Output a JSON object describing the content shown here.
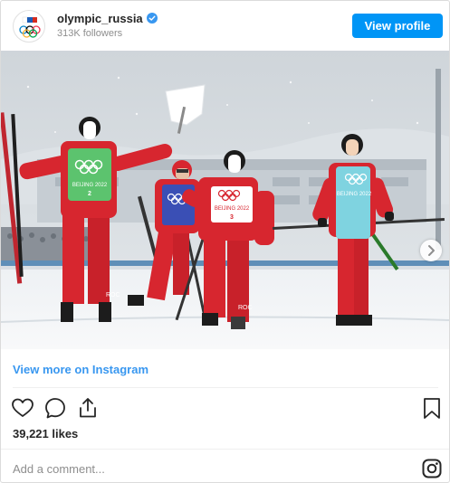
{
  "header": {
    "username": "olympic_russia",
    "followers": "313K followers",
    "view_profile_label": "View profile"
  },
  "photo": {
    "bibs": {
      "left": "BEIJING 2022",
      "center": "BEIJING 2022",
      "right": "BEIJING 2022"
    },
    "roc_left": "ROC",
    "roc_center": "ROC"
  },
  "footer": {
    "view_more_label": "View more on Instagram",
    "likes": "39,221 likes",
    "comment_placeholder": "Add a comment..."
  },
  "colors": {
    "accent": "#0095f6",
    "link": "#3897f0",
    "suit_red": "#d7262f",
    "bib_green": "#5cc36e",
    "bib_cyan": "#7fd3e0",
    "snow": "#f4f6f8"
  },
  "icons": {
    "avatar": "olympic-rings-avatar",
    "verified": "verified-badge-icon",
    "next": "chevron-right-icon",
    "like": "heart-icon",
    "comment": "comment-bubble-icon",
    "share": "share-icon",
    "save": "bookmark-icon",
    "instagram": "instagram-logo-icon"
  }
}
